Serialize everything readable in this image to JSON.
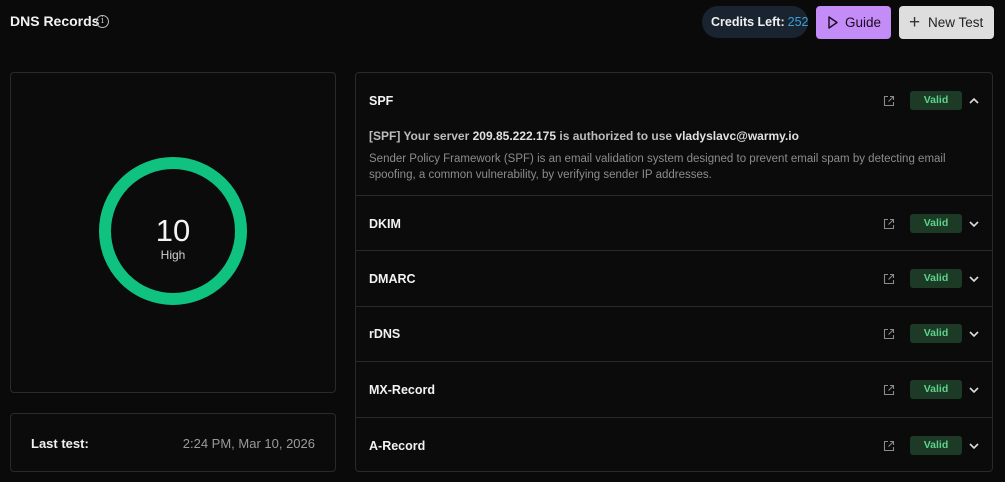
{
  "header": {
    "title": "DNS Records",
    "credits_label": "Credits Left:",
    "credits_value": "252",
    "guide_label": "Guide",
    "new_test_label": "New Test"
  },
  "score": {
    "value": "10",
    "level": "High",
    "fraction": 1.0,
    "ring_color": "#10c27f"
  },
  "last_test": {
    "label": "Last test:",
    "value": "2:24 PM, Mar 10, 2026"
  },
  "records": [
    {
      "name": "SPF",
      "status": "Valid",
      "expanded": true,
      "detail_prefix": "[SPF] Your server",
      "detail_ip": "209.85.222.175",
      "detail_mid": "is authorized to use",
      "detail_email": "vladyslavc@warmy.io",
      "description": "Sender Policy Framework (SPF) is an email validation system designed to prevent email spam by detecting email spoofing, a common vulnerability, by verifying sender IP addresses."
    },
    {
      "name": "DKIM",
      "status": "Valid",
      "expanded": false
    },
    {
      "name": "DMARC",
      "status": "Valid",
      "expanded": false
    },
    {
      "name": "rDNS",
      "status": "Valid",
      "expanded": false
    },
    {
      "name": "MX-Record",
      "status": "Valid",
      "expanded": false
    },
    {
      "name": "A-Record",
      "status": "Valid",
      "expanded": false
    }
  ],
  "colors": {
    "accent_purple": "#c48cf7",
    "valid_bg": "#1d3a27",
    "valid_text": "#5bd48a",
    "credits_num": "#3ba0d8"
  }
}
